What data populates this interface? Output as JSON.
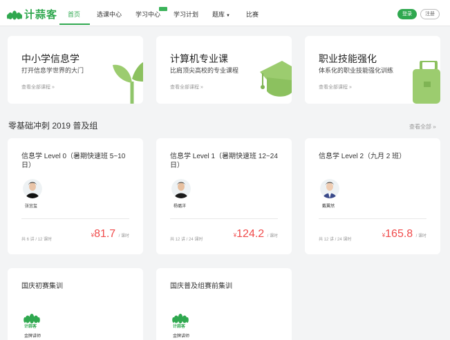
{
  "brand": {
    "name": "计蒜客",
    "color": "#2fa84f"
  },
  "nav": {
    "items": [
      "首页",
      "选课中心",
      "学习中心",
      "学习计划",
      "题库",
      "比赛"
    ],
    "active": "首页",
    "login": "登录",
    "register": "注册"
  },
  "categories": [
    {
      "title": "中小学信息学",
      "subtitle": "打开信息学世界的大门",
      "link": "查看全部课程 »",
      "icon": "sprout-icon"
    },
    {
      "title": "计算机专业课",
      "subtitle": "比肩顶尖高校的专业课程",
      "link": "查看全部课程 »",
      "icon": "graduation-cap-icon"
    },
    {
      "title": "职业技能强化",
      "subtitle": "体系化的职业技能强化训练",
      "link": "查看全部课程 »",
      "icon": "briefcase-icon"
    }
  ],
  "section": {
    "title": "零基础冲刺 2019 普及组",
    "more": "查看全部 »"
  },
  "courses": [
    {
      "title": "信息学 Level 0（暑期快速班 5~10 日）",
      "teacher": "张宜玺",
      "lessons": "共 6 讲 / 12 课时",
      "price_symbol": "¥",
      "price": "81.7",
      "price_unit": "/ 课时"
    },
    {
      "title": "信息学 Level 1（暑期快速班 12~24 日）",
      "teacher": "杨璐洋",
      "lessons": "共 12 讲 / 24 课时",
      "price_symbol": "¥",
      "price": "124.2",
      "price_unit": "/ 课时"
    },
    {
      "title": "信息学 Level 2（九月 2 班）",
      "teacher": "戴翼然",
      "lessons": "共 12 讲 / 24 课时",
      "price_symbol": "¥",
      "price": "165.8",
      "price_unit": "/ 课时"
    },
    {
      "title": "国庆初赛集训",
      "teacher": "金牌讲师",
      "brand_text": "计蒜客"
    },
    {
      "title": "国庆普及组赛前集训",
      "teacher": "金牌讲师",
      "brand_text": "计蒜客"
    }
  ]
}
